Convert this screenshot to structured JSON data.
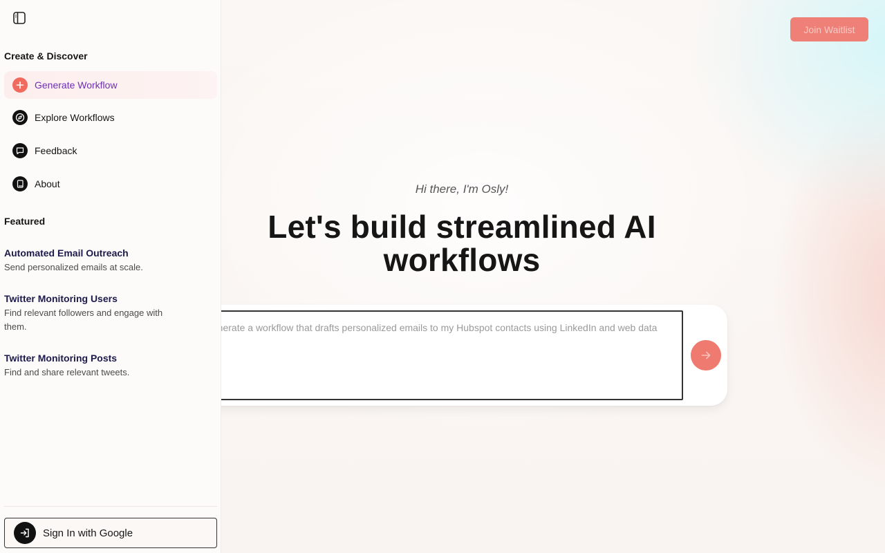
{
  "sidebar": {
    "create_discover_title": "Create & Discover",
    "nav": [
      {
        "label": "Generate Workflow",
        "icon": "plus-icon"
      },
      {
        "label": "Explore Workflows",
        "icon": "compass-icon"
      },
      {
        "label": "Feedback",
        "icon": "chat-bubble-icon"
      },
      {
        "label": "About",
        "icon": "book-icon"
      }
    ],
    "featured_title": "Featured",
    "featured": [
      {
        "title": "Automated Email Outreach",
        "desc": "Send personalized emails at scale."
      },
      {
        "title": "Twitter Monitoring Users",
        "desc": "Find relevant followers and engage with them."
      },
      {
        "title": "Twitter Monitoring Posts",
        "desc": "Find and share relevant tweets."
      }
    ],
    "signin_label": "Sign In with Google"
  },
  "header": {
    "join_label": "Join Waitlist"
  },
  "main": {
    "greeting": "Hi there, I'm Osly!",
    "headline": "Let's build streamlined AI workflows",
    "prompt_text": "Generate a workflow that drafts personalized emails to my Hubspot contacts using LinkedIn and web data"
  },
  "colors": {
    "accent": "#f06b5d",
    "active_label": "#6b2fb3",
    "featured_title": "#1b1a4a"
  }
}
